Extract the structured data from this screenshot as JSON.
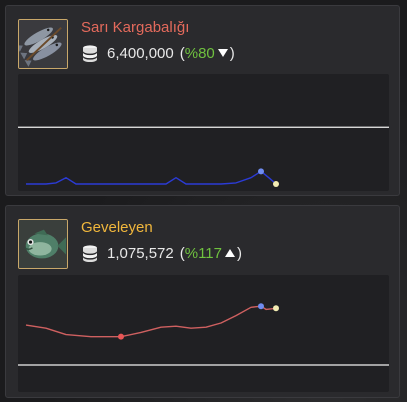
{
  "items": [
    {
      "name": "Sarı Kargabalığı",
      "name_color": "#e46a5c",
      "price": "6,400,000",
      "percent": "%80",
      "trend": "down",
      "icon": "sardines-icon",
      "chart_data": {
        "type": "line",
        "y_range": [
          0,
          100
        ],
        "reference_line": 55,
        "series": [
          {
            "color": "#2b3bd6",
            "points": [
              [
                0,
                1
              ],
              [
                20,
                1
              ],
              [
                30,
                2
              ],
              [
                40,
                7
              ],
              [
                50,
                1
              ],
              [
                60,
                1
              ],
              [
                80,
                1
              ],
              [
                100,
                1
              ],
              [
                130,
                1
              ],
              [
                140,
                1
              ],
              [
                150,
                7
              ],
              [
                160,
                1
              ],
              [
                175,
                1
              ],
              [
                195,
                1
              ],
              [
                210,
                2
              ],
              [
                225,
                7
              ],
              [
                235,
                13
              ],
              [
                244,
                6
              ],
              [
                250,
                1
              ]
            ]
          }
        ],
        "markers": [
          {
            "x": 235,
            "y": 13,
            "color": "#6f8cf0"
          },
          {
            "x": 250,
            "y": 1,
            "color": "#f3ecb3"
          }
        ]
      }
    },
    {
      "name": "Geveleyen",
      "name_color": "#f1b73c",
      "price": "1,075,572",
      "percent": "%117",
      "trend": "up",
      "icon": "fish-icon",
      "chart_data": {
        "type": "line",
        "y_range": [
          0,
          100
        ],
        "reference_line": 20,
        "series": [
          {
            "color": "#cf6060",
            "points": [
              [
                0,
                58
              ],
              [
                20,
                55
              ],
              [
                40,
                49
              ],
              [
                65,
                47
              ],
              [
                95,
                47
              ],
              [
                115,
                51
              ],
              [
                135,
                56
              ],
              [
                150,
                57
              ],
              [
                165,
                55
              ],
              [
                180,
                56
              ],
              [
                195,
                60
              ],
              [
                210,
                67
              ],
              [
                225,
                75
              ],
              [
                235,
                76
              ],
              [
                240,
                73
              ],
              [
                250,
                74
              ]
            ]
          }
        ],
        "markers": [
          {
            "x": 95,
            "y": 47,
            "color": "#e85656"
          },
          {
            "x": 235,
            "y": 76,
            "color": "#6f8cf0"
          },
          {
            "x": 250,
            "y": 74,
            "color": "#f3ecb3"
          }
        ]
      }
    }
  ]
}
